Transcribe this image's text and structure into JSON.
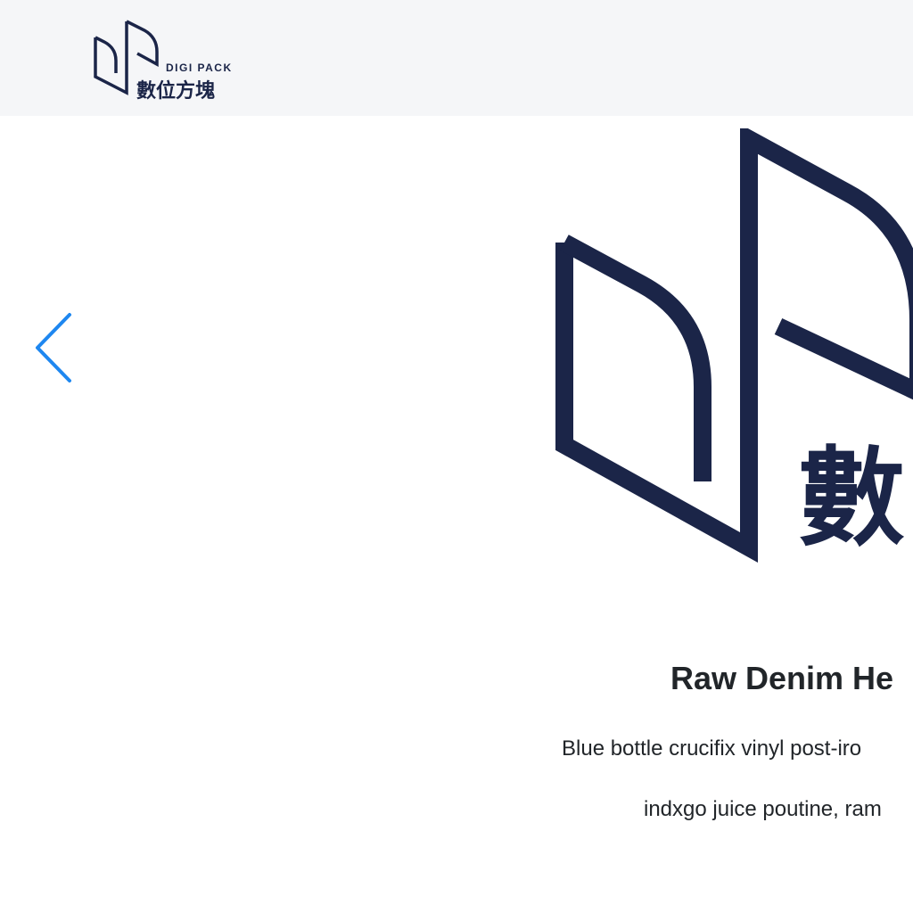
{
  "header": {
    "brand_en": "DIGI PACK",
    "brand_zh": "數位方塊"
  },
  "carousel": {
    "prev_icon": "chevron-left-icon",
    "slide": {
      "logo_zh": "數",
      "title": "Raw Denim He",
      "text_line_1": "Blue bottle crucifix vinyl post-iro",
      "text_line_2": "indxgo juice poutine, ram"
    }
  },
  "colors": {
    "brand_navy": "#1b2548",
    "accent_blue": "#1e87f0",
    "header_bg": "#f5f6f8",
    "text": "#212529"
  }
}
